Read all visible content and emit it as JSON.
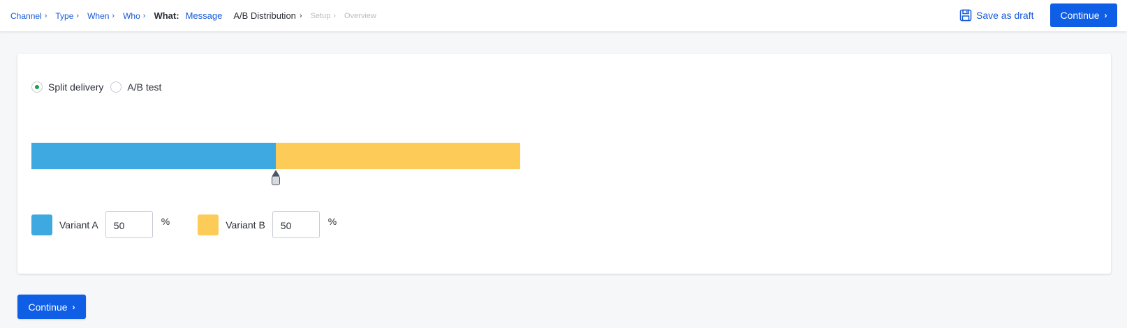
{
  "breadcrumb": {
    "steps": [
      "Channel",
      "Type",
      "When",
      "Who"
    ],
    "what_label": "What:",
    "message_label": "Message",
    "ab_label": "A/B Distribution",
    "disabled_steps": [
      "Setup",
      "Overview"
    ]
  },
  "header": {
    "save_draft_label": "Save as draft",
    "continue_label": "Continue"
  },
  "distribution": {
    "mode_options": [
      "Split delivery",
      "A/B test"
    ],
    "selected_mode": "Split delivery",
    "variants": [
      {
        "label": "Variant A",
        "value": "50",
        "percent": 50,
        "color": "#3ea8e0"
      },
      {
        "label": "Variant B",
        "value": "50",
        "percent": 50,
        "color": "#fdcb58"
      }
    ],
    "percent_symbol": "%"
  },
  "footer": {
    "continue_label": "Continue"
  },
  "colors": {
    "accent": "#0f5ee6",
    "link": "#1559d6",
    "radio_selected": "#1aa14a"
  }
}
